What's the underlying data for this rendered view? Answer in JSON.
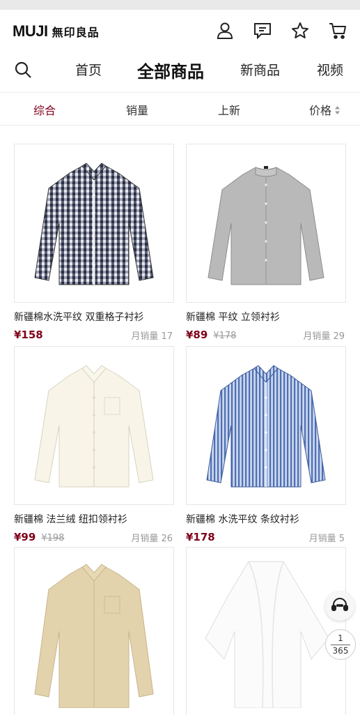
{
  "header": {
    "brand": "MUJI",
    "brand_cn": "無印良品",
    "icons": [
      "user-icon",
      "message-icon",
      "star-icon",
      "cart-icon"
    ]
  },
  "nav": {
    "search_icon": "search-icon",
    "tabs": [
      {
        "label": "首页",
        "active": false
      },
      {
        "label": "全部商品",
        "active": true
      },
      {
        "label": "新商品",
        "active": false
      },
      {
        "label": "视频",
        "active": false
      }
    ]
  },
  "sort": {
    "items": [
      {
        "label": "综合",
        "active": true
      },
      {
        "label": "销量",
        "active": false
      },
      {
        "label": "上新",
        "active": false
      },
      {
        "label": "价格",
        "active": false
      }
    ]
  },
  "products": [
    {
      "name": "新疆棉水洗平纹 双重格子衬衫",
      "price": "¥158",
      "old_price": "",
      "sales": "月销量 17",
      "image": "gingham-shirt"
    },
    {
      "name": "新疆棉 平纹 立领衬衫",
      "price": "¥89",
      "old_price": "¥178",
      "sales": "月销量 29",
      "image": "grey-collarless-shirt"
    },
    {
      "name": "新疆棉 法兰绒 纽扣领衬衫",
      "price": "¥99",
      "old_price": "¥198",
      "sales": "月销量 26",
      "image": "cream-flannel-shirt"
    },
    {
      "name": "新疆棉 水洗平纹 条纹衬衫",
      "price": "¥178",
      "old_price": "",
      "sales": "月销量 5",
      "image": "blue-stripe-shirt"
    },
    {
      "name": "",
      "price": "",
      "old_price": "",
      "sales": "",
      "image": "beige-oxford-shirt"
    },
    {
      "name": "",
      "price": "",
      "old_price": "",
      "sales": "",
      "image": "white-shawl"
    }
  ],
  "pager": {
    "current": "1",
    "total": "365"
  },
  "colors": {
    "accent": "#7f0019",
    "muted": "#999999"
  }
}
